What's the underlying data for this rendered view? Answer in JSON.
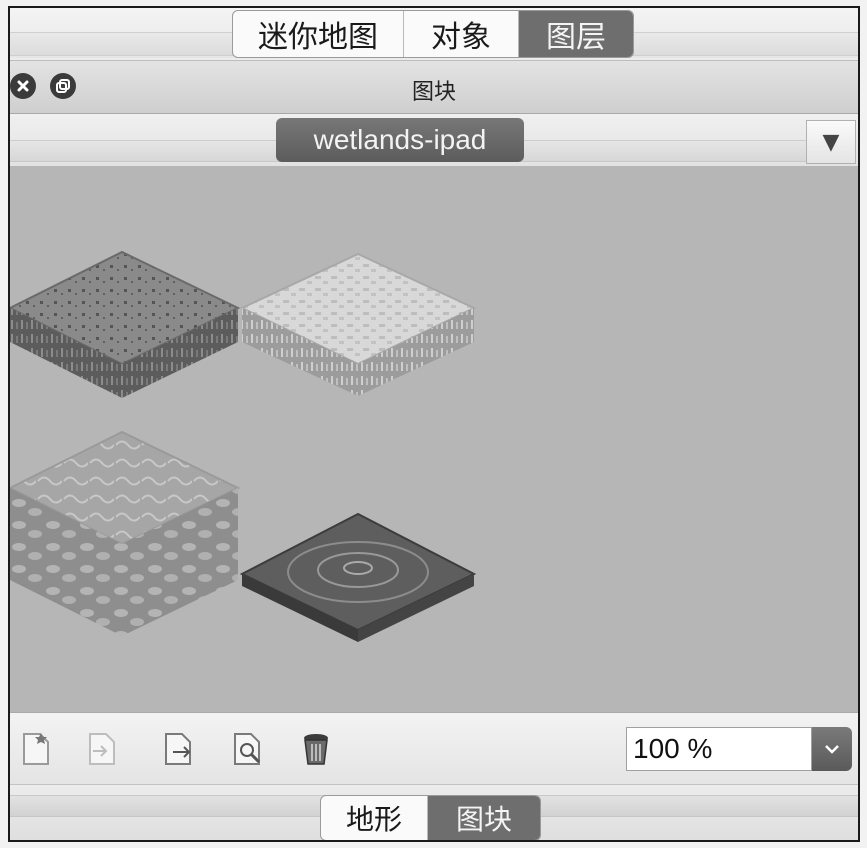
{
  "top_tabs": [
    {
      "label": "迷你地图",
      "active": false
    },
    {
      "label": "对象",
      "active": false
    },
    {
      "label": "图层",
      "active": true
    }
  ],
  "panel": {
    "title": "图块",
    "close_icon": "close-icon",
    "float_icon": "float-icon"
  },
  "tileset_tab": {
    "label": "wetlands-ipad",
    "menu_glyph": "▼"
  },
  "toolbar": {
    "tools": [
      "new-tileset-icon",
      "import-tileset-icon",
      "export-tileset-icon",
      "edit-tileset-icon",
      "delete-tileset-icon"
    ],
    "zoom_value": "100 %"
  },
  "bottom_tabs": [
    {
      "label": "地形",
      "active": false
    },
    {
      "label": "图块",
      "active": true
    }
  ],
  "colors": {
    "canvas_bg": "#b6b6b6",
    "active_tab": "#6e6e6e"
  }
}
